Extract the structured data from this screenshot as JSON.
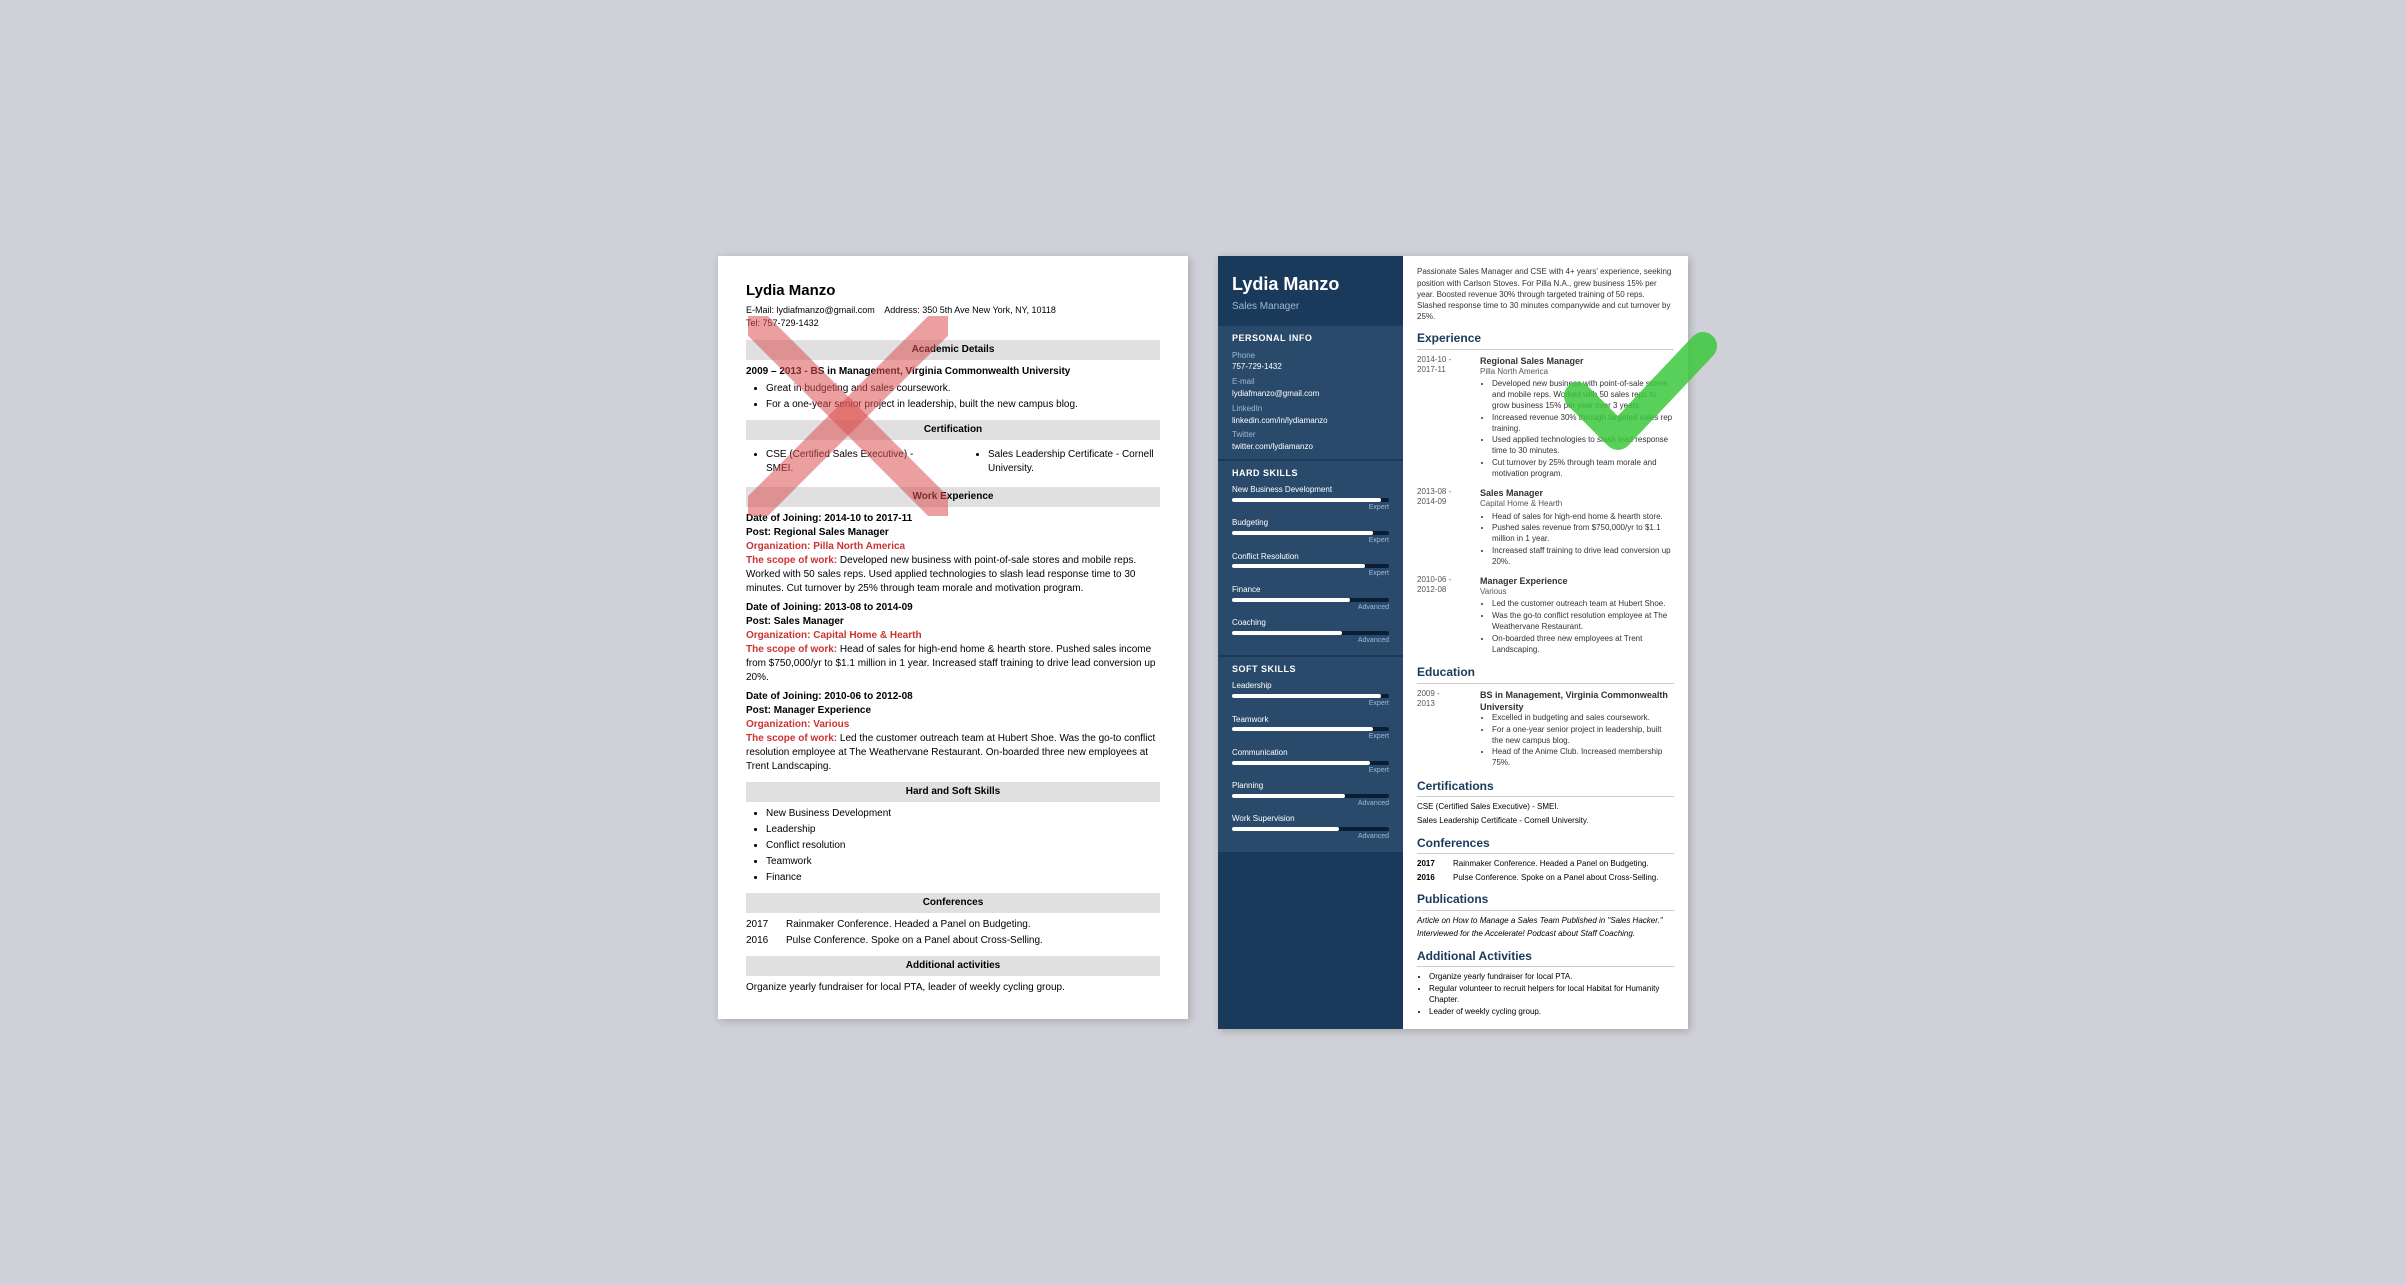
{
  "left": {
    "name": "Lydia Manzo",
    "email_label": "E-Mail:",
    "email": "lydiafmanzo@gmail.com",
    "address_label": "Address:",
    "address": "350 5th Ave New York, NY, 10118",
    "tel_label": "Tel:",
    "tel": "757-729-1432",
    "sections": {
      "academic": "Academic Details",
      "cert": "Certification",
      "work": "Work Experience",
      "skills": "Hard and Soft Skills",
      "conferences": "Conferences",
      "additional": "Additional activities"
    },
    "education": {
      "year": "2009 – 2013 - BS in Management, Virginia Commonwealth University",
      "bullets": [
        "Great in budgeting and sales coursework.",
        "For a one-year senior project in leadership, built the new campus blog."
      ]
    },
    "certifications": [
      "CSE (Certified Sales Executive) - SMEI.",
      "Sales Leadership Certificate - Cornell University."
    ],
    "work_experience": [
      {
        "date": "Date of Joining: 2014-10 to 2017-11",
        "post": "Post: Regional Sales Manager",
        "org": "Organization: Pilla North America",
        "scope_label": "The scope of work:",
        "scope": "Developed new business with point-of-sale stores and mobile reps. Worked with 50 sales reps. Used applied technologies to slash lead response time to 30 minutes. Cut turnover by 25% through team morale and motivation program."
      },
      {
        "date": "Date of Joining: 2013-08 to 2014-09",
        "post": "Post: Sales Manager",
        "org": "Organization: Capital Home & Hearth",
        "scope_label": "The scope of work:",
        "scope": "Head of sales for high-end home & hearth store. Pushed sales income from $750,000/yr to $1.1 million in 1 year. Increased staff training to drive lead conversion up 20%."
      },
      {
        "date": "Date of Joining: 2010-06 to 2012-08",
        "post": "Post: Manager Experience",
        "org": "Organization: Various",
        "scope_label": "The scope of work:",
        "scope": "Led the customer outreach team at Hubert Shoe. Was the go-to conflict resolution employee at The Weathervane Restaurant. On-boarded three new employees at Trent Landscaping."
      }
    ],
    "skills": [
      "New Business Development",
      "Leadership",
      "Conflict resolution",
      "Teamwork",
      "Finance"
    ],
    "conferences": [
      {
        "year": "2017",
        "desc": "Rainmaker Conference. Headed a Panel on Budgeting."
      },
      {
        "year": "2016",
        "desc": "Pulse Conference. Spoke on a Panel about Cross-Selling."
      }
    ],
    "additional": "Organize yearly fundraiser for local PTA, leader of weekly cycling group."
  },
  "right": {
    "name": "Lydia Manzo",
    "title": "Sales Manager",
    "summary": "Passionate Sales Manager and CSE with 4+ years' experience, seeking position with Carlson Stoves. For Pilla N.A., grew business 15% per year. Boosted revenue 30% through targeted training of 50 reps. Slashed response time to 30 minutes companywide and cut turnover by 25%.",
    "personal_info": {
      "section_title": "Personal Info",
      "phone_label": "Phone",
      "phone": "757-729-1432",
      "email_label": "E-mail",
      "email": "lydiafmanzo@gmail.com",
      "linkedin_label": "LinkedIn",
      "linkedin": "linkedin.com/in/lydiamanzo",
      "twitter_label": "Twitter",
      "twitter": "twitter.com/lydiamanzo"
    },
    "hard_skills": {
      "section_title": "Hard Skills",
      "items": [
        {
          "name": "New Business Development",
          "pct": 95,
          "level": "Expert"
        },
        {
          "name": "Budgeting",
          "pct": 90,
          "level": "Expert"
        },
        {
          "name": "Conflict Resolution",
          "pct": 85,
          "level": "Expert"
        },
        {
          "name": "Finance",
          "pct": 75,
          "level": "Advanced"
        },
        {
          "name": "Coaching",
          "pct": 70,
          "level": "Advanced"
        }
      ]
    },
    "soft_skills": {
      "section_title": "Soft Skills",
      "items": [
        {
          "name": "Leadership",
          "pct": 95,
          "level": "Expert"
        },
        {
          "name": "Teamwork",
          "pct": 90,
          "level": "Expert"
        },
        {
          "name": "Communication",
          "pct": 88,
          "level": "Expert"
        },
        {
          "name": "Planning",
          "pct": 72,
          "level": "Advanced"
        },
        {
          "name": "Work Supervision",
          "pct": 68,
          "level": "Advanced"
        }
      ]
    },
    "experience": {
      "section_title": "Experience",
      "items": [
        {
          "dates": "2014-10 -\n2017-11",
          "title": "Regional Sales Manager",
          "org": "Pilla North America",
          "bullets": [
            "Developed new business with point-of-sale stores and mobile reps. Worked with 50 sales reps to grow business 15% per year over 3 years.",
            "Increased revenue 30% through targeted sales rep training.",
            "Used applied technologies to slash lead response time to 30 minutes.",
            "Cut turnover by 25% through team morale and motivation program."
          ]
        },
        {
          "dates": "2013-08 -\n2014-09",
          "title": "Sales Manager",
          "org": "Capital Home & Hearth",
          "bullets": [
            "Head of sales for high-end home & hearth store.",
            "Pushed sales revenue from $750,000/yr to $1.1 million in 1 year.",
            "Increased staff training to drive lead conversion up 20%."
          ]
        },
        {
          "dates": "2010-06 -\n2012-08",
          "title": "Manager Experience",
          "org": "Various",
          "bullets": [
            "Led the customer outreach team at Hubert Shoe.",
            "Was the go-to conflict resolution employee at The Weathervane Restaurant.",
            "On-boarded three new employees at Trent Landscaping."
          ]
        }
      ]
    },
    "education": {
      "section_title": "Education",
      "items": [
        {
          "dates": "2009 -\n2013",
          "title": "BS in Management, Virginia Commonwealth University",
          "bullets": [
            "Excelled in budgeting and sales coursework.",
            "For a one-year senior project in leadership, built the new campus blog.",
            "Head of the Anime Club. Increased membership 75%."
          ]
        }
      ]
    },
    "certifications": {
      "section_title": "Certifications",
      "items": [
        "CSE (Certified Sales Executive) - SMEI.",
        "Sales Leadership Certificate - Cornell University."
      ]
    },
    "conferences": {
      "section_title": "Conferences",
      "items": [
        {
          "year": "2017",
          "desc": "Rainmaker Conference. Headed a Panel on Budgeting."
        },
        {
          "year": "2016",
          "desc": "Pulse Conference. Spoke on a Panel about Cross-Selling."
        }
      ]
    },
    "publications": {
      "section_title": "Publications",
      "items": [
        "Article on How to Manage a Sales Team Published in \"Sales Hacker.\"",
        "Interviewed for the Accelerate! Podcast about Staff Coaching."
      ]
    },
    "additional": {
      "section_title": "Additional Activities",
      "items": [
        "Organize yearly fundraiser for local PTA.",
        "Regular volunteer to recruit helpers for local Habitat for Humanity Chapter.",
        "Leader of weekly cycling group."
      ]
    }
  }
}
